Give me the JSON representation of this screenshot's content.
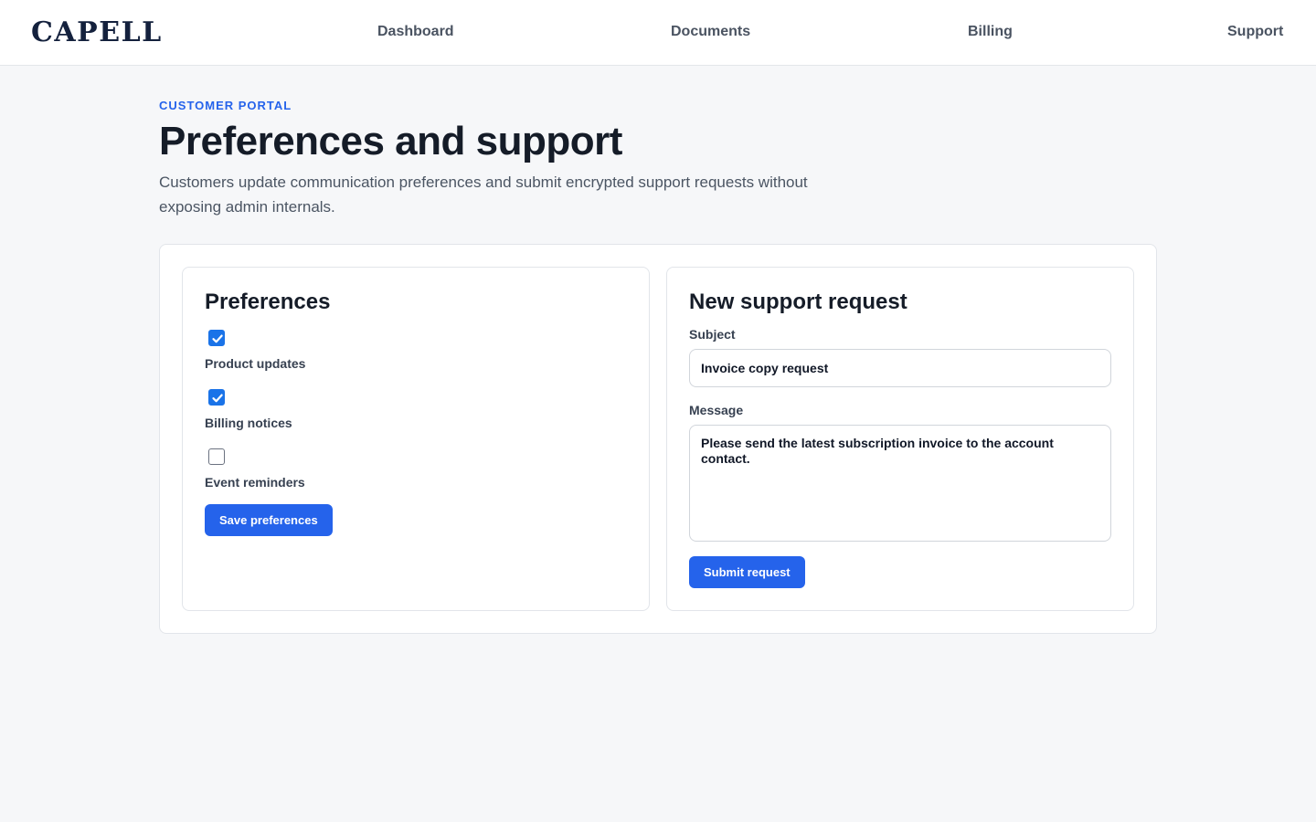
{
  "header": {
    "logo": "CAPELL",
    "nav": [
      "Dashboard",
      "Documents",
      "Billing",
      "Support"
    ]
  },
  "hero": {
    "eyebrow": "CUSTOMER PORTAL",
    "title": "Preferences and support",
    "description": "Customers update communication preferences and submit encrypted support requests without exposing admin internals."
  },
  "preferences": {
    "title": "Preferences",
    "items": [
      {
        "label": "Product updates",
        "checked": true
      },
      {
        "label": "Billing notices",
        "checked": true
      },
      {
        "label": "Event reminders",
        "checked": false
      }
    ],
    "save_label": "Save preferences"
  },
  "support": {
    "title": "New support request",
    "subject_label": "Subject",
    "subject_value": "Invoice copy request",
    "message_label": "Message",
    "message_value": "Please send the latest subscription invoice to the account contact.",
    "submit_label": "Submit request"
  },
  "colors": {
    "accent": "#2563eb",
    "checkbox": "#1a73e8",
    "background": "#f6f7f9"
  }
}
